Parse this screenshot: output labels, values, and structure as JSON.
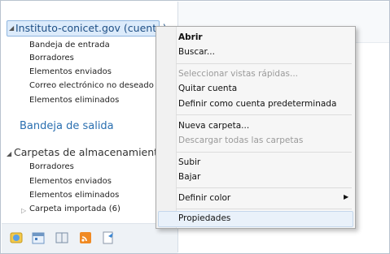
{
  "account": {
    "label": "Instituto-conicet.gov (cuenta)"
  },
  "folders_top": [
    {
      "label": "Bandeja de entrada"
    },
    {
      "label": "Borradores"
    },
    {
      "label": "Elementos enviados"
    },
    {
      "label": "Correo electrónico no deseado"
    },
    {
      "label": "Elementos eliminados"
    }
  ],
  "outbox": {
    "label": "Bandeja de salida"
  },
  "storage": {
    "label": "Carpetas de almacenamiento",
    "items": [
      {
        "label": "Borradores"
      },
      {
        "label": "Elementos enviados"
      },
      {
        "label": "Elementos eliminados"
      },
      {
        "label": "Carpeta importada (6)"
      }
    ]
  },
  "bottom_nav": {
    "icons": [
      "mail-icon",
      "calendar-icon",
      "contacts-icon",
      "feeds-icon",
      "newsgroups-icon"
    ]
  },
  "context_menu": {
    "items": [
      {
        "label": "Abrir",
        "enabled": true,
        "bold": true
      },
      {
        "label": "Buscar...",
        "enabled": true
      },
      {
        "label": "Seleccionar vistas rápidas...",
        "enabled": false
      },
      {
        "label": "Quitar cuenta",
        "enabled": true
      },
      {
        "label": "Definir como cuenta predeterminada",
        "enabled": true
      },
      {
        "label": "Nueva carpeta...",
        "enabled": true
      },
      {
        "label": "Descargar todas las carpetas",
        "enabled": false
      },
      {
        "label": "Subir",
        "enabled": true
      },
      {
        "label": "Bajar",
        "enabled": true
      },
      {
        "label": "Definir color",
        "enabled": true,
        "submenu": true
      },
      {
        "label": "Propiedades",
        "enabled": true,
        "highlighted": true
      }
    ]
  }
}
